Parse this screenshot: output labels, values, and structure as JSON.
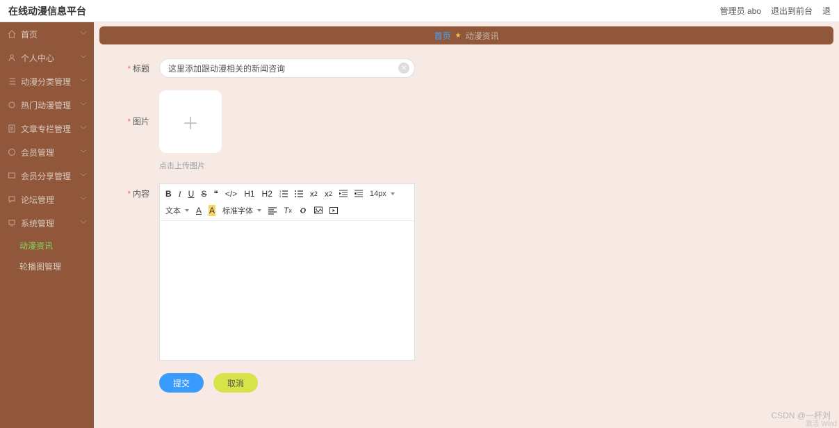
{
  "header": {
    "title": "在线动漫信息平台",
    "user_label": "管理员 abo",
    "exit_label": "退出到前台",
    "logout_label": "退"
  },
  "sidebar": {
    "items": [
      {
        "icon": "home",
        "label": "首页"
      },
      {
        "icon": "user",
        "label": "个人中心"
      },
      {
        "icon": "list",
        "label": "动漫分类管理"
      },
      {
        "icon": "fire",
        "label": "热门动漫管理"
      },
      {
        "icon": "doc",
        "label": "文章专栏管理"
      },
      {
        "icon": "member",
        "label": "会员管理"
      },
      {
        "icon": "share",
        "label": "会员分享管理"
      },
      {
        "icon": "forum",
        "label": "论坛管理"
      },
      {
        "icon": "system",
        "label": "系统管理"
      }
    ],
    "subs": [
      {
        "label": "动漫资讯",
        "active": true
      },
      {
        "label": "轮播图管理",
        "active": false
      }
    ]
  },
  "crumb": {
    "home": "首页",
    "current": "动漫资讯"
  },
  "form": {
    "title_label": "标题",
    "title_value": "这里添加跟动漫相关的新闻咨询",
    "image_label": "图片",
    "upload_tip": "点击上传图片",
    "content_label": "内容",
    "toolbar": {
      "h1": "H1",
      "h2": "H2",
      "sub": "x",
      "sup": "x",
      "sub2": "2",
      "sup2": "2",
      "fontsize": "14px",
      "texttype": "文本",
      "fontfamily": "标准字体"
    },
    "submit": "提交",
    "cancel": "取消"
  },
  "watermark": "CSDN @一杯刘",
  "watermark2": "激活 Wind"
}
